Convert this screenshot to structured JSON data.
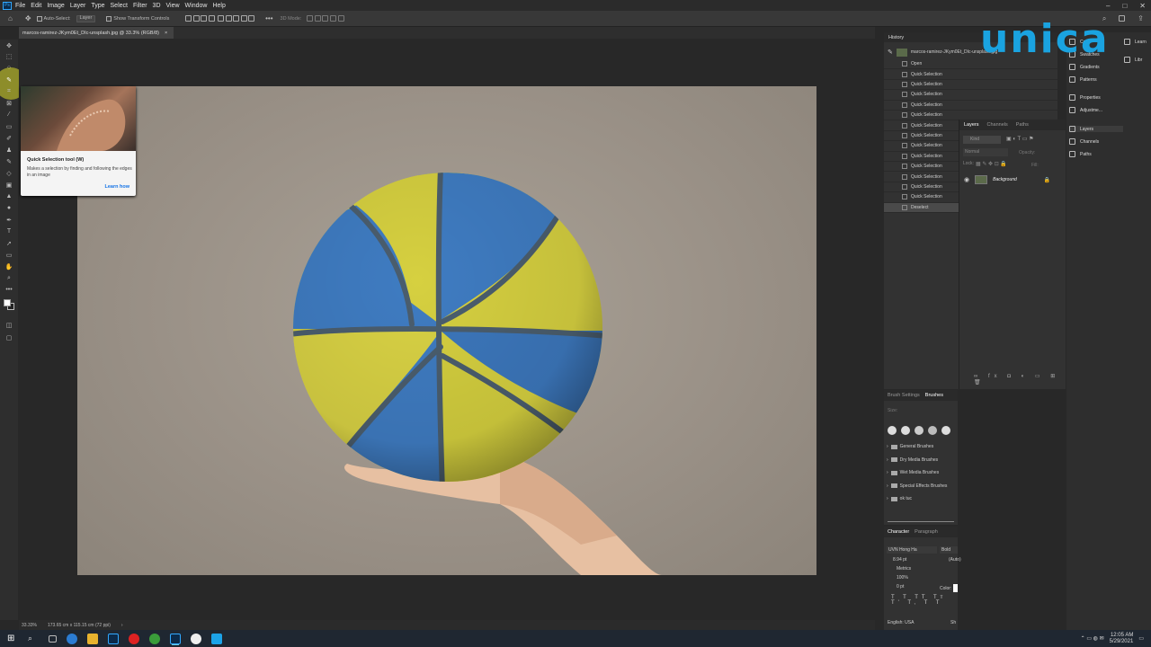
{
  "menu": [
    "File",
    "Edit",
    "Image",
    "Layer",
    "Type",
    "Select",
    "Filter",
    "3D",
    "View",
    "Window",
    "Help"
  ],
  "options": {
    "auto_select": "Auto-Select:",
    "layer_dd": "Layer",
    "transform": "Show Transform Controls",
    "mode3d": "3D Mode:"
  },
  "document": {
    "tab": "marcos-ramirez-JKym0Et_DIc-unsplash.jpg @ 33.3% (RGB/8)",
    "zoom": "33.33%",
    "size": "173.65 cm x 115.15 cm (72 ppi)"
  },
  "tooltip": {
    "title": "Quick Selection tool (W)",
    "desc": "Makes a selection by finding and following the edges in an image",
    "link": "Learn how"
  },
  "history": {
    "title": "History",
    "snapshot": "marcos-ramirez-JKym0Et_DIc-unsplash.jpg",
    "items": [
      "Open",
      "Quick Selection",
      "Quick Selection",
      "Quick Selection",
      "Quick Selection",
      "Quick Selection",
      "Quick Selection",
      "Quick Selection",
      "Quick Selection",
      "Quick Selection",
      "Quick Selection",
      "Quick Selection",
      "Quick Selection",
      "Quick Selection",
      "Deselect"
    ]
  },
  "layers_panel": {
    "tabs": [
      "Layers",
      "Channels",
      "Paths"
    ],
    "kind": "Kind",
    "blend": "Normal",
    "opacity_label": "Opacity:",
    "lock_label": "Lock:",
    "fill_label": "Fill:",
    "layer_name": "Background"
  },
  "brushes_panel": {
    "tabs": [
      "Brush Settings",
      "Brushes"
    ],
    "size_label": "Size:",
    "folders": [
      "General Brushes",
      "Dry Media Brushes",
      "Wet Media Brushes",
      "Special Effects Brushes",
      "ok tuc"
    ]
  },
  "character_panel": {
    "tabs": [
      "Character",
      "Paragraph"
    ],
    "font": "UVN Hong Ha",
    "style": "Bold",
    "size": "8.94 pt",
    "auto": "(Auto)",
    "kerning": "Metrics",
    "scale": "100%",
    "baseline": "0 pt",
    "color_label": "Color:",
    "lang": "English: USA",
    "sharp": "Sh"
  },
  "right_column": {
    "items": [
      "Color",
      "Swatches",
      "Gradients",
      "Patterns",
      "Properties",
      "Adjustme...",
      "Layers",
      "Channels",
      "Paths"
    ],
    "learn": "Learn",
    "libs": "Libr"
  },
  "logo": "unica",
  "clock": {
    "time": "12:05 AM",
    "date": "5/29/2021"
  },
  "colors": {
    "accent": "#1473e6",
    "logo": "#1aa3e0",
    "ball_yellow": "#d8d240",
    "ball_blue": "#3e7ac0"
  }
}
